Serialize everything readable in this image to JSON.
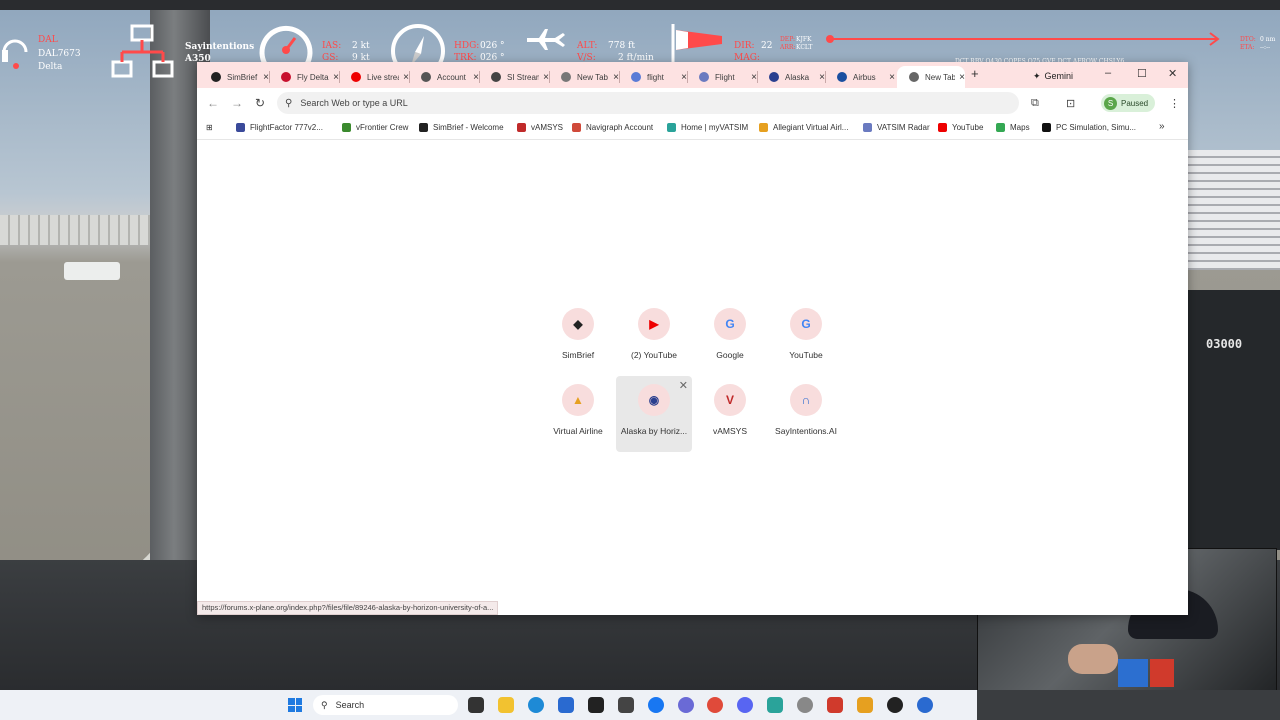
{
  "hud": {
    "callsign_airline": "DAL",
    "callsign_flight": "DAL7673",
    "callsign_name": "Delta",
    "network_name": "Sayintentions",
    "aircraft": "A350",
    "ias_label": "IAS:",
    "ias_value": "2 kt",
    "gs_label": "GS:",
    "gs_value": "9 kt",
    "hdg_label": "HDG:",
    "hdg_value": "026 °",
    "trk_label": "TRK:",
    "trk_value": "026 °",
    "alt_label": "ALT:",
    "alt_value": "778 ft",
    "vs_label": "V/S:",
    "vs_value": "2 ft/min",
    "dir_label": "DIR:",
    "dir_value": "22",
    "mag_label": "MAG:",
    "dep_label": "DEP:",
    "dep_value": "KJFK",
    "arr_label": "ARR:",
    "arr_value": "KCLT",
    "dto_label": "DTO:",
    "eta_label": "ETA:",
    "dto_value": "0 nm",
    "eta_value": "--:--",
    "route": "DCT RBV Q430 COPES Q75 GVE DCT AFROW CHSLY6"
  },
  "browser": {
    "tabs": [
      {
        "label": "SimBrief",
        "color": "#222"
      },
      {
        "label": "Fly Delta",
        "color": "#c8102e"
      },
      {
        "label": "Live stream",
        "color": "#e00"
      },
      {
        "label": "Account",
        "color": "#555"
      },
      {
        "label": "SI Stream",
        "color": "#444"
      },
      {
        "label": "New Tab",
        "color": "#777"
      },
      {
        "label": "flight",
        "color": "#5a7bd6"
      },
      {
        "label": "Flight",
        "color": "#6a7ac0"
      },
      {
        "label": "Alaska",
        "color": "#2a3f8f"
      },
      {
        "label": "Airbus",
        "color": "#1a4fa0"
      },
      {
        "label": "New Tab",
        "color": "#666",
        "active": true
      }
    ],
    "newtab_symbol": "+",
    "gemini_label": "Gemini",
    "minimize": "–",
    "maximize": "☐",
    "close": "✕",
    "omnibox_placeholder": "Search Web or type a URL",
    "profile_initial": "S",
    "profile_status": "Paused",
    "bookmarks": [
      {
        "label": "FlightFactor 777v2...",
        "color": "#3a4a9a"
      },
      {
        "label": "vFrontier Crew",
        "color": "#3b8a2e"
      },
      {
        "label": "SimBrief - Welcome",
        "color": "#222"
      },
      {
        "label": "vAMSYS",
        "color": "#c02a2a"
      },
      {
        "label": "Navigraph Account",
        "color": "#d04a3a"
      },
      {
        "label": "Home | myVATSIM",
        "color": "#2aa39a"
      },
      {
        "label": "Allegiant Virtual Airl...",
        "color": "#e6a020"
      },
      {
        "label": "VATSIM Radar",
        "color": "#6a7ac0"
      },
      {
        "label": "YouTube",
        "color": "#e00"
      },
      {
        "label": "Maps",
        "color": "#34a853"
      },
      {
        "label": "PC Simulation, Simu...",
        "color": "#111"
      }
    ],
    "more_bookmarks": "»",
    "shortcuts": [
      {
        "label": "SimBrief",
        "glyph": "◆",
        "color": "#222"
      },
      {
        "label": "(2) YouTube",
        "glyph": "▶",
        "color": "#e00"
      },
      {
        "label": "Google",
        "glyph": "G",
        "color": "#4285f4"
      },
      {
        "label": "YouTube",
        "glyph": "G",
        "color": "#4285f4"
      },
      {
        "label": "Virtual Airline",
        "glyph": "▲",
        "color": "#e6a020"
      },
      {
        "label": "Alaska by Horiz...",
        "glyph": "◉",
        "color": "#2a3f8f"
      },
      {
        "label": "vAMSYS",
        "glyph": "V",
        "color": "#c02a2a"
      },
      {
        "label": "SayIntentions.AI",
        "glyph": "∩",
        "color": "#2a6ad0"
      }
    ],
    "status_url": "https://forums.x-plane.org/index.php?/files/file/89246-alaska-by-horizon-university-of-a..."
  },
  "scene": {
    "altitude_display": "03000"
  },
  "taskbar": {
    "search_label": "Search"
  }
}
